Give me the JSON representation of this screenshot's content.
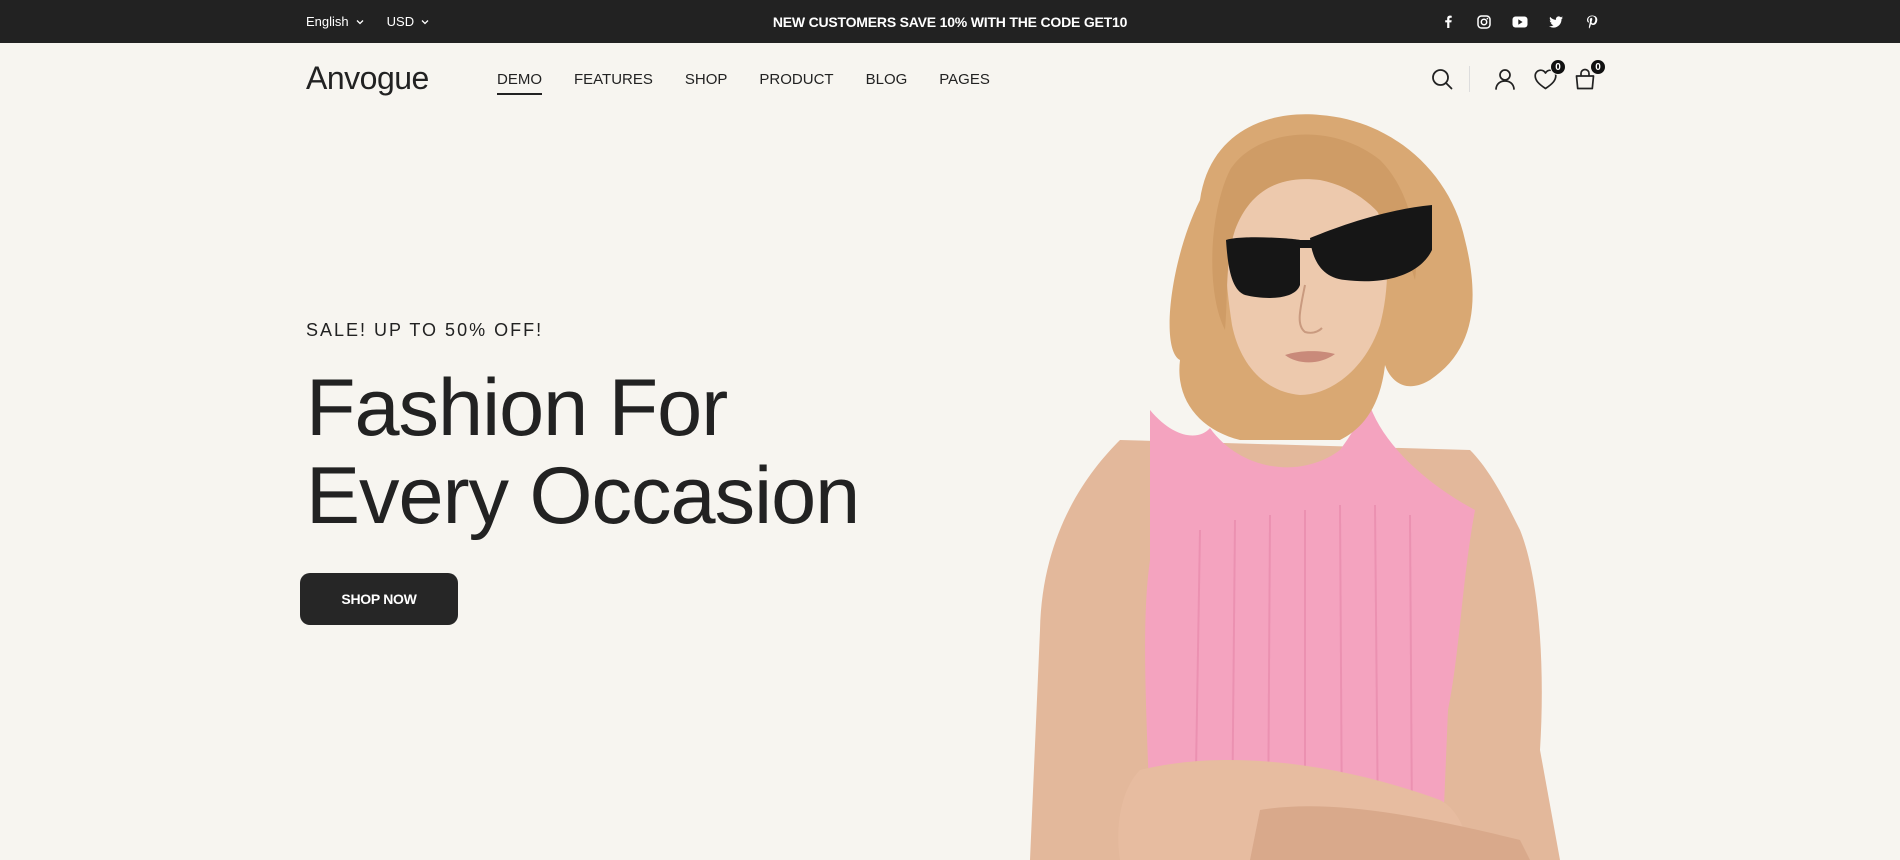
{
  "topbar": {
    "language": "English",
    "currency": "USD",
    "promo": "NEW CUSTOMERS SAVE 10% WITH THE CODE GET10",
    "social": [
      "facebook-icon",
      "instagram-icon",
      "youtube-icon",
      "twitter-icon",
      "pinterest-icon"
    ]
  },
  "header": {
    "logo": "Anvogue",
    "nav": [
      "DEMO",
      "FEATURES",
      "SHOP",
      "PRODUCT",
      "BLOG",
      "PAGES"
    ],
    "active_nav": "DEMO",
    "wishlist_count": "0",
    "cart_count": "0"
  },
  "hero": {
    "eyebrow": "SALE! UP TO 50% OFF!",
    "headline_line1": "Fashion For",
    "headline_line2": "Every Occasion",
    "cta": "SHOP NOW"
  },
  "colors": {
    "background": "#f7f5f0",
    "topbar": "#222222",
    "button": "#262626",
    "top_garment": "#f4a3bf"
  }
}
